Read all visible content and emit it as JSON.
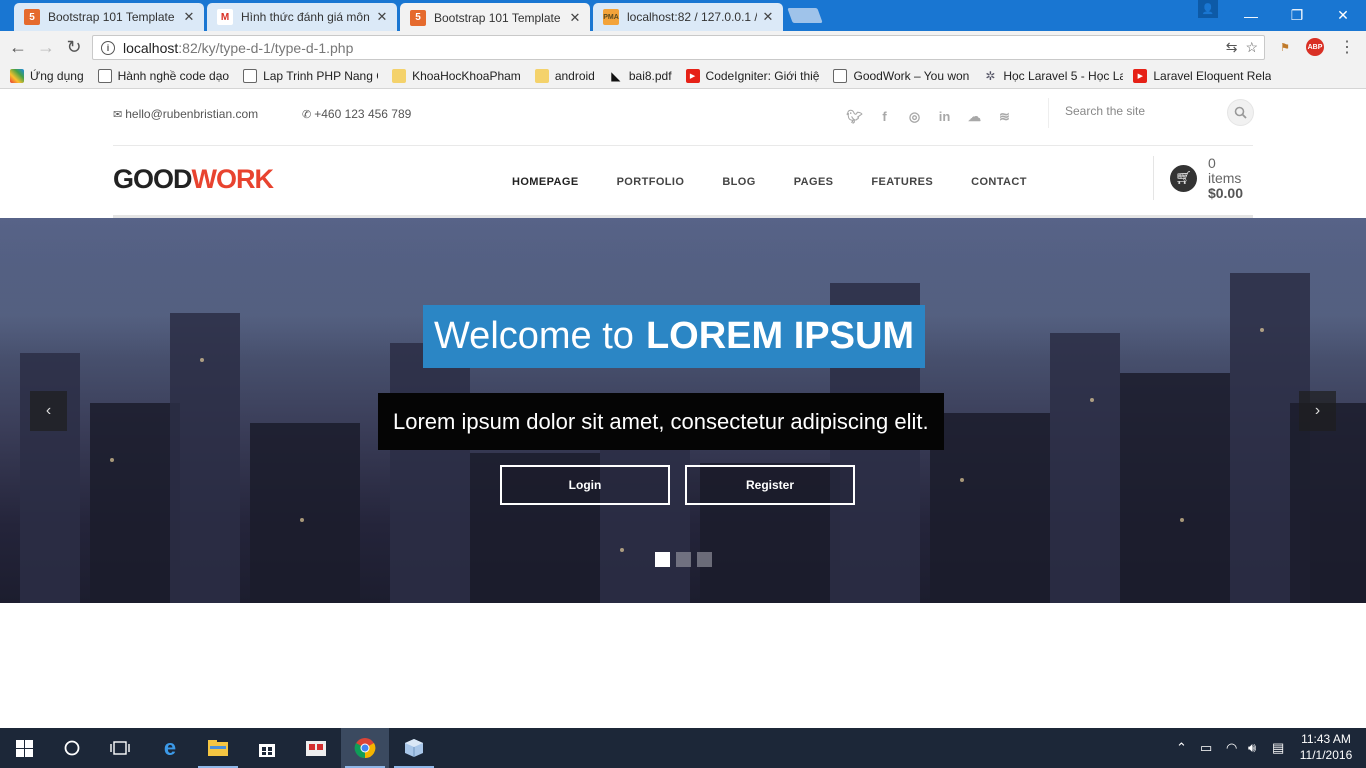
{
  "browser": {
    "tabs": [
      {
        "title": "Bootstrap 101 Template",
        "icon": "html5-icon",
        "active": false
      },
      {
        "title": "Hình thức đánh giá môn",
        "icon": "gmail-icon",
        "active": false
      },
      {
        "title": "Bootstrap 101 Template",
        "icon": "html5-icon",
        "active": true
      },
      {
        "title": "localhost:82 / 127.0.0.1 /",
        "icon": "phpmyadmin-icon",
        "active": false
      }
    ],
    "url_host": "localhost",
    "url_path": ":82/ky/type-d-1/type-d-1.php",
    "bookmarks": [
      {
        "label": "Ứng dụng",
        "icon": "apps-icon"
      },
      {
        "label": "Hành nghề code dạo",
        "icon": "page-icon"
      },
      {
        "label": "Lap Trinh PHP Nang C",
        "icon": "page-icon"
      },
      {
        "label": "KhoaHocKhoaPham",
        "icon": "folder-icon"
      },
      {
        "label": "android",
        "icon": "folder-icon"
      },
      {
        "label": "bai8.pdf",
        "icon": "pdf-icon"
      },
      {
        "label": "CodeIgniter: Giới thiệ",
        "icon": "youtube-icon"
      },
      {
        "label": "GoodWork – You won",
        "icon": "page-icon"
      },
      {
        "label": "Học Laravel 5 - Học La",
        "icon": "laravel-icon"
      },
      {
        "label": "Laravel Eloquent Relat",
        "icon": "youtube-icon"
      }
    ],
    "ext_abp": "ABP"
  },
  "site": {
    "email": "hello@rubenbristian.com",
    "phone": "+460 123 456 789",
    "search_placeholder": "Search the site",
    "logo_dark": "GOOD",
    "logo_accent": "WORK",
    "menu": [
      "HOMEPAGE",
      "PORTFOLIO",
      "BLOG",
      "PAGES",
      "FEATURES",
      "CONTACT"
    ],
    "cart_items": "0 items",
    "cart_total": "$0.00",
    "hero": {
      "title_light": "Welcome to",
      "title_bold": "LOREM IPSUM",
      "subtitle": "Lorem ipsum dolor sit amet, consectetur adipiscing elit.",
      "login": "Login",
      "register": "Register"
    }
  },
  "taskbar": {
    "time": "11:43 AM",
    "date": "11/1/2016"
  },
  "colors": {
    "accent_red": "#e8432f",
    "hero_title_bg": "#2b86c5",
    "chrome_blue": "#1976d2"
  }
}
